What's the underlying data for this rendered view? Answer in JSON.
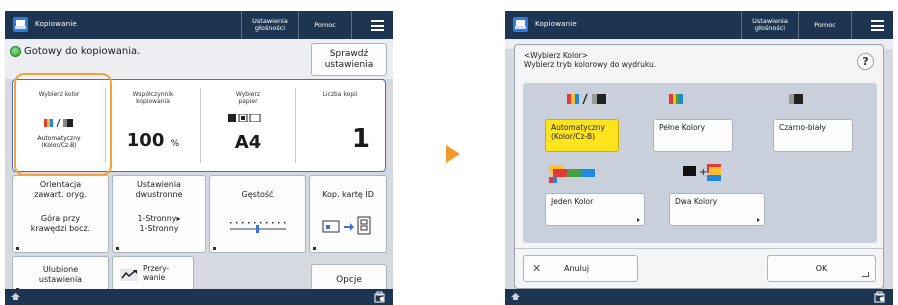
{
  "left_screen": {
    "title": "Kopiowanie",
    "header_buttons": {
      "density": "Ustawienia\ngłośności",
      "help": "Pomoc"
    },
    "status": "Gotowy do kopiowania.",
    "check_settings": "Sprawdź\nustawienia",
    "settings": {
      "color": {
        "label": "Wybierz kolor",
        "value": "Automatyczny\n(Kolor/Cz-B)"
      },
      "ratio": {
        "label": "Współczynnik\nkopiowania",
        "value": "100",
        "unit": "%"
      },
      "paper": {
        "label": "Wybierz\npapier",
        "value": "A4"
      },
      "copies": {
        "label": "Liczba kopii",
        "value": "1"
      }
    },
    "buttons": {
      "orientation": {
        "title": "Orientacja\nzawart. oryg.",
        "sub": "Góra przy\nkrawędzi bocz."
      },
      "duplex": {
        "title": "Ustawienia\ndwustronne",
        "sub": "1-Stronny▸\n1-Stronny"
      },
      "density": {
        "title": "Gęstość"
      },
      "id_card": {
        "title": "Kop. kartę ID"
      },
      "favorites": "Ulubione\nustawienia",
      "interrupt": "Przery-\nwanie",
      "options": "Opcje"
    }
  },
  "right_screen": {
    "title": "Kopiowanie",
    "header_buttons": {
      "density": "Ustawienia\ngłośności",
      "help": "Pomoc"
    },
    "dialog": {
      "title": "<Wybierz Kolor>\nWybierz tryb kolorowy do wydruku.",
      "help": "?",
      "options": [
        {
          "label": "Automatyczny\n(Kolor/Cz-B)",
          "selected": true
        },
        {
          "label": "Pełne Kolory",
          "selected": false
        },
        {
          "label": "Czarno-biały",
          "selected": false
        },
        {
          "label": "Jeden Kolor",
          "selected": false
        },
        {
          "label": "Dwa Kolory",
          "selected": false
        }
      ],
      "cancel": "Anuluj",
      "ok": "OK"
    }
  },
  "colors": {
    "accent_orange": "#f2a33b",
    "selected_yellow": "#ffe31c",
    "title_bar": "#1e3552",
    "focus_blue": "#3e6fd4"
  }
}
